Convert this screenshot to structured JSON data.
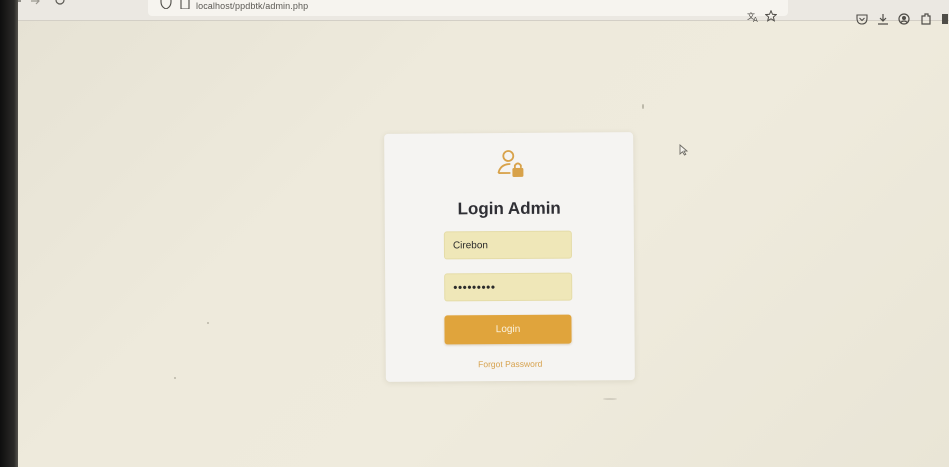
{
  "browser": {
    "url": "localhost/ppdbtk/admin.php",
    "icons": [
      "back-icon",
      "forward-icon",
      "reload-icon",
      "shield-icon",
      "page-icon",
      "translate-icon",
      "bookmark-star-icon",
      "pocket-icon",
      "download-icon",
      "account-icon",
      "extensions-icon"
    ]
  },
  "login": {
    "title": "Login Admin",
    "icon": "user-lock-icon",
    "username_value": "Cirebon",
    "password_value": "•••••••••",
    "login_label": "Login",
    "forgot_label": "Forgot Password"
  },
  "colors": {
    "accent": "#e0a43c",
    "field_bg": "#efe7b8",
    "card_bg": "#f5f4f2",
    "page_bg": "#ece8da",
    "title": "#2f2f35",
    "link": "#d7a24e"
  }
}
